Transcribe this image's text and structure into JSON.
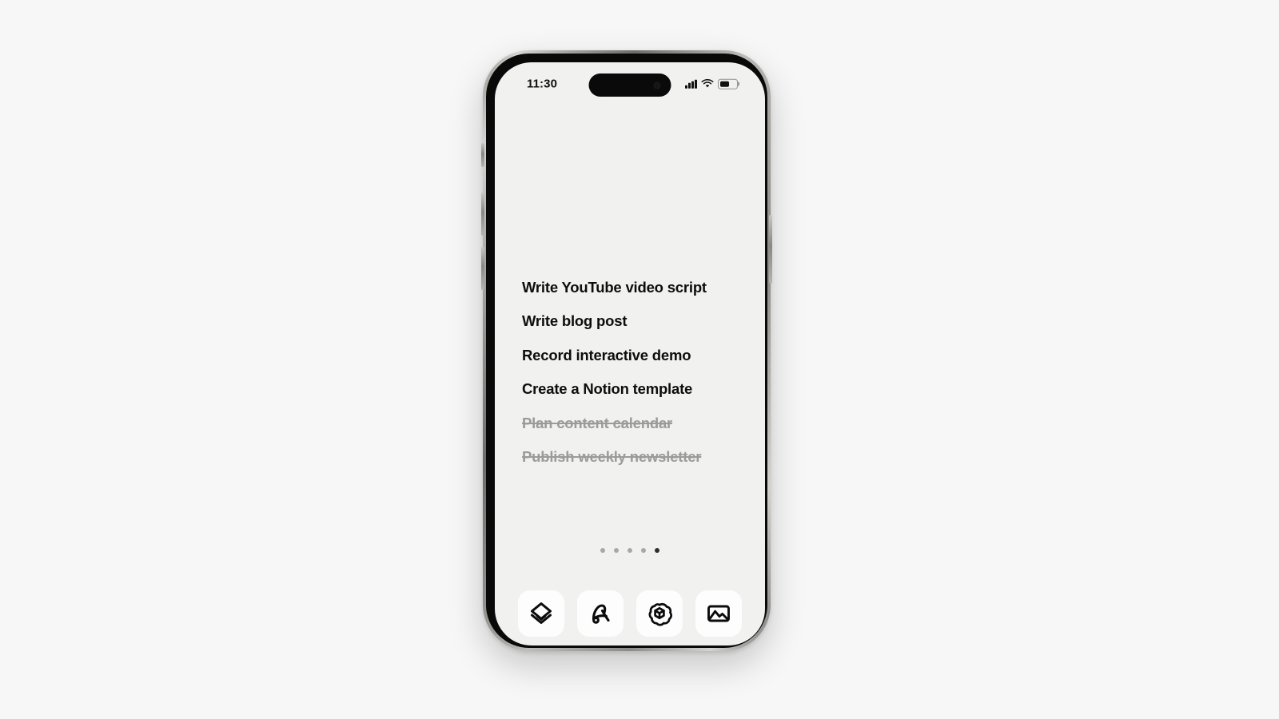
{
  "page": {
    "background_color": "#f7f7f7",
    "device": "iphone-mockup"
  },
  "device": {
    "screen_background": "#f1f1f0",
    "frame_color": "#a9a7a3"
  },
  "status_bar": {
    "time": "11:30",
    "cellular_icon": "cellular-bars-icon",
    "cellular_bars": 4,
    "wifi_icon": "wifi-icon",
    "battery_icon": "battery-icon",
    "battery_level_percent": 55
  },
  "tasks": [
    {
      "label": "Write YouTube video script",
      "completed": false
    },
    {
      "label": "Write blog post",
      "completed": false
    },
    {
      "label": "Record interactive demo",
      "completed": false
    },
    {
      "label": "Create a Notion template",
      "completed": false
    },
    {
      "label": "Plan content calendar",
      "completed": true
    },
    {
      "label": "Publish weekly newsletter",
      "completed": true
    }
  ],
  "pagination": {
    "total_pages": 5,
    "active_page": 5,
    "dot_color": "#aaa8a6",
    "active_dot_color": "#2e2e2e"
  },
  "dock": {
    "apps": [
      {
        "name": "Linear",
        "icon": "stacked-diamond-icon"
      },
      {
        "name": "Arc",
        "icon": "arc-browser-icon"
      },
      {
        "name": "ChatGPT",
        "icon": "openai-logo-icon"
      },
      {
        "name": "Photos",
        "icon": "photo-image-icon"
      }
    ],
    "tile_background": "#fdfdfd",
    "icon_color": "#0b0b0b"
  },
  "hardware_buttons": [
    {
      "name": "action-button",
      "side": "left"
    },
    {
      "name": "volume-up-button",
      "side": "left"
    },
    {
      "name": "volume-down-button",
      "side": "left"
    },
    {
      "name": "power-button",
      "side": "right"
    }
  ]
}
